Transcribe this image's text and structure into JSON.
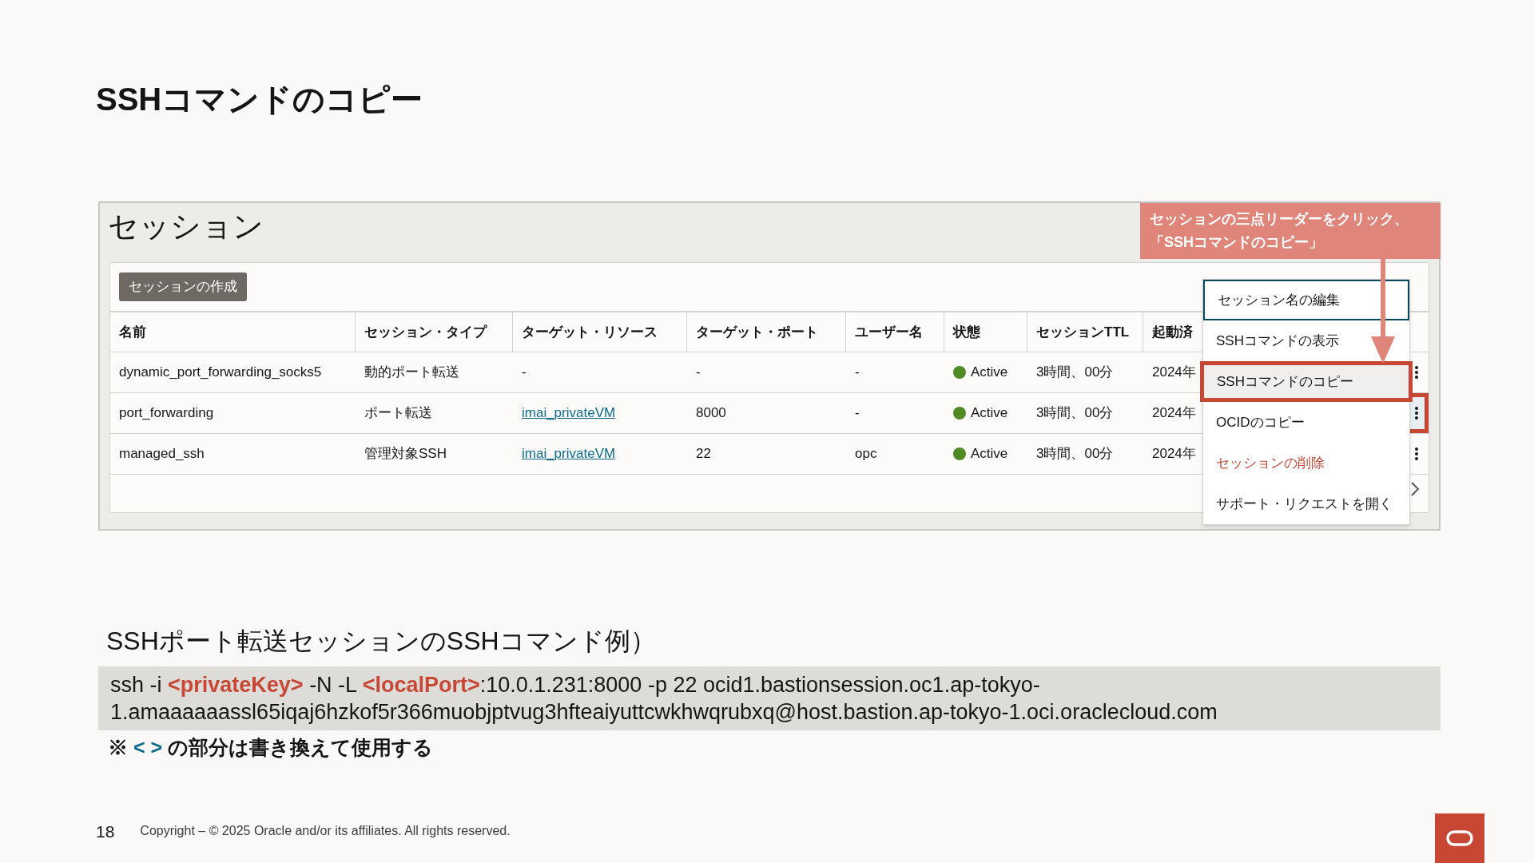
{
  "title": "SSHコマンドのコピー",
  "console": {
    "heading": "セッション",
    "create_button": "セッションの作成",
    "columns": [
      "名前",
      "セッション・タイプ",
      "ターゲット・リソース",
      "ターゲット・ポート",
      "ユーザー名",
      "状態",
      "セッションTTL",
      "起動済"
    ],
    "rows": [
      {
        "name": "dynamic_port_forwarding_socks5",
        "type": "動的ポート転送",
        "resource": "-",
        "resource_link": false,
        "port": "-",
        "user": "-",
        "state": "Active",
        "color": "#4f8a25",
        "ttl": "3時間、00分",
        "started": "2024年",
        "highlighted": false
      },
      {
        "name": "port_forwarding",
        "type": "ポート転送",
        "resource": "imai_privateVM",
        "resource_link": true,
        "port": "8000",
        "user": "-",
        "state": "Active",
        "color": "#4f8a25",
        "ttl": "3時間、00分",
        "started": "2024年",
        "highlighted": true
      },
      {
        "name": "managed_ssh",
        "type": "管理対象SSH",
        "resource": "imai_privateVM",
        "resource_link": true,
        "port": "22",
        "user": "opc",
        "state": "Active",
        "color": "#4f8a25",
        "ttl": "3時間、00分",
        "started": "2024年",
        "highlighted": false
      }
    ],
    "menu": [
      {
        "label": "セッション名の編集",
        "kind": "normal",
        "focused": true,
        "selected": false
      },
      {
        "label": "SSHコマンドの表示",
        "kind": "normal",
        "focused": false,
        "selected": false
      },
      {
        "label": "SSHコマンドのコピー",
        "kind": "normal",
        "focused": false,
        "selected": true
      },
      {
        "label": "OCIDのコピー",
        "kind": "normal",
        "focused": false,
        "selected": false
      },
      {
        "label": "セッションの削除",
        "kind": "danger",
        "focused": false,
        "selected": false
      },
      {
        "label": "サポート・リクエストを開く",
        "kind": "normal",
        "focused": false,
        "selected": false
      }
    ],
    "callout": [
      "セッションの三点リーダーをクリック、",
      "「SSHコマンドのコピー」"
    ]
  },
  "example": {
    "label": "SSHポート転送セッションのSSHコマンド例）",
    "lines": [
      [
        {
          "text": "ssh -i ",
          "kind": "plain"
        },
        {
          "text": "<privateKey>",
          "kind": "placeholder"
        },
        {
          "text": " -N -L ",
          "kind": "plain"
        },
        {
          "text": "<localPort>",
          "kind": "placeholder"
        },
        {
          "text": ":10.0.1.231:8000 -p 22 ocid1.bastionsession.oc1.ap-tokyo-",
          "kind": "plain"
        }
      ],
      [
        {
          "text": "1.amaaaaaassl65iqaj6hzkof5r366muobjptvug3hfteaiyuttcwkhwqrubxq@host.bastion.ap-tokyo-1.oci.oraclecloud.com",
          "kind": "plain"
        }
      ]
    ],
    "note": [
      {
        "text": "※ ",
        "kind": "plain"
      },
      {
        "text": "< >",
        "kind": "accent"
      },
      {
        "text": " の部分は書き換えて使用する",
        "kind": "plain"
      }
    ]
  },
  "footer": {
    "page": "18",
    "copyright": "Copyright – © 2025 Oracle and/or its affiliates. All rights reserved."
  }
}
